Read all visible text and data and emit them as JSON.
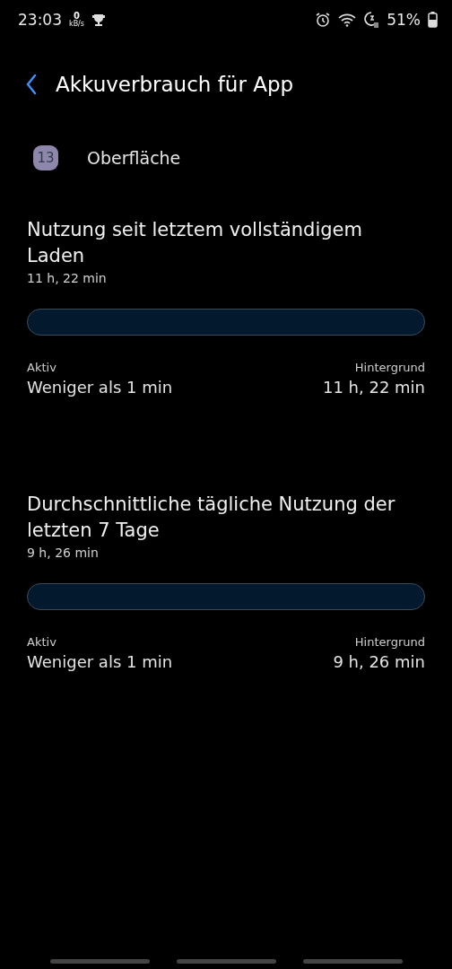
{
  "status_bar": {
    "time": "23:03",
    "speed_value": "0",
    "speed_unit": "kB/s",
    "battery": "51%"
  },
  "header": {
    "title": "Akkuverbrauch für App"
  },
  "app": {
    "icon_text": "13",
    "name": "Oberfläche"
  },
  "sections": [
    {
      "title": "Nutzung seit letztem vollständigem Laden",
      "total": "11 h, 22 min",
      "level": 0,
      "active_label": "Aktiv",
      "active_value": "Weniger als 1 min",
      "background_label": "Hintergrund",
      "background_value": "11 h, 22 min"
    },
    {
      "title": "Durchschnittliche tägliche Nutzung der letzten 7 Tage",
      "total": "9 h, 26 min",
      "level": 0,
      "active_label": "Aktiv",
      "active_value": "Weniger als 1 min",
      "background_label": "Hintergrund",
      "background_value": "9 h, 26 min"
    }
  ]
}
